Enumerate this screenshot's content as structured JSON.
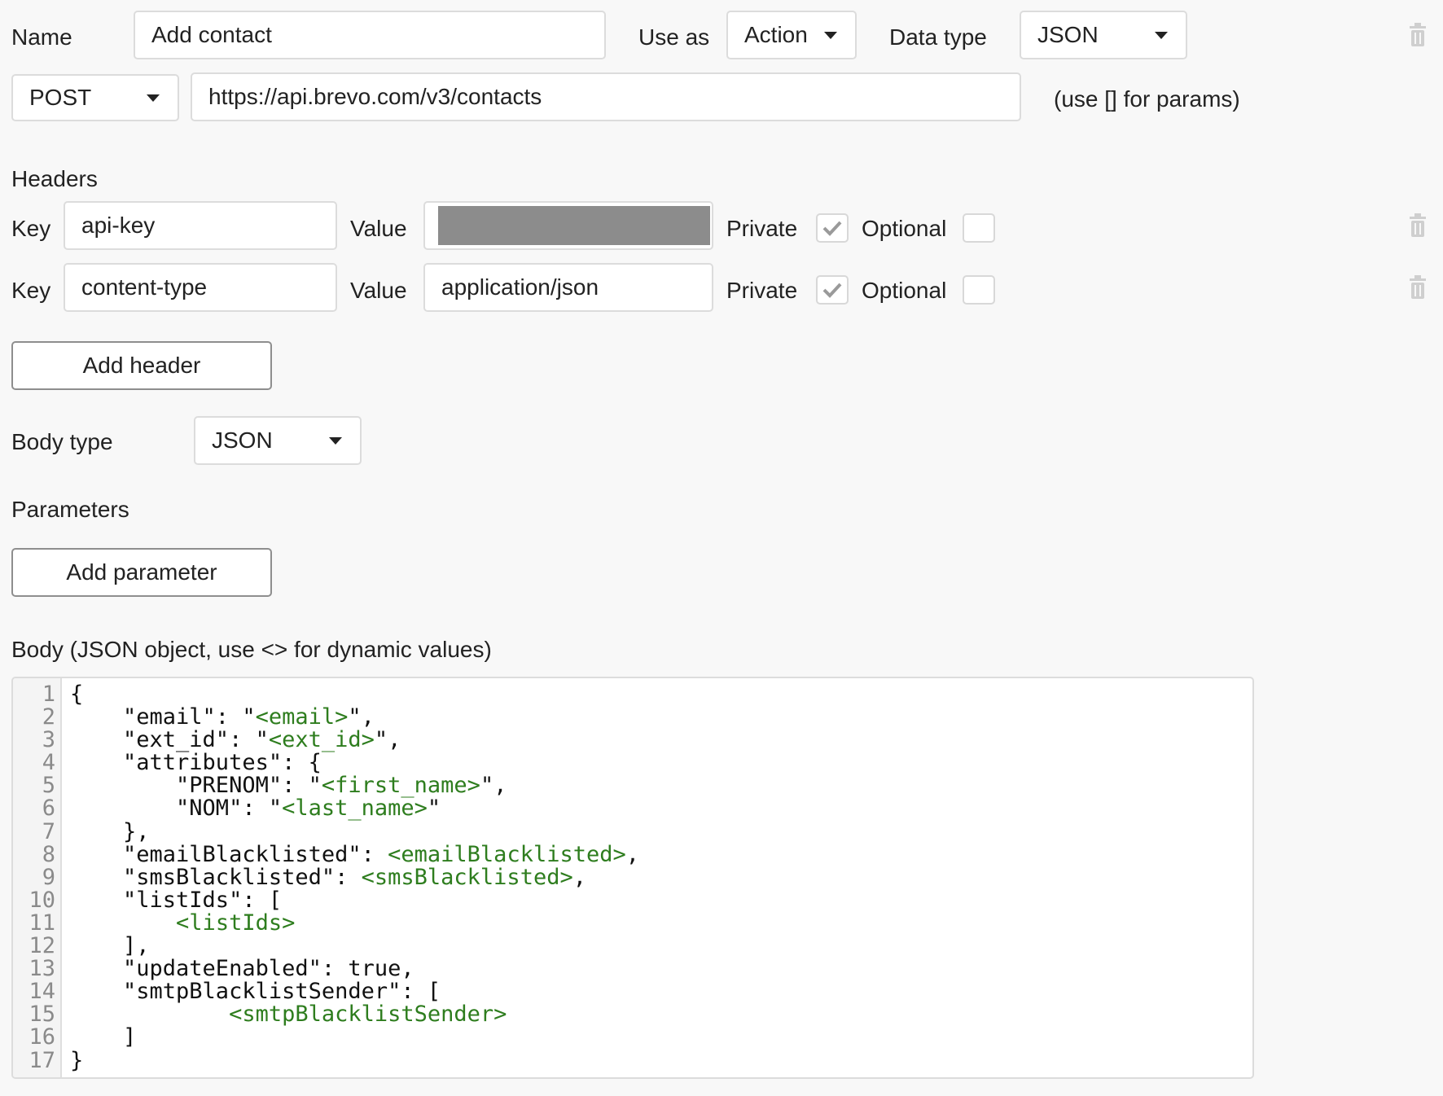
{
  "name_row": {
    "name_label": "Name",
    "name_value": "Add contact",
    "use_as_label": "Use as",
    "use_as_value": "Action",
    "data_type_label": "Data type",
    "data_type_value": "JSON"
  },
  "request_row": {
    "method": "POST",
    "url": "https://api.brevo.com/v3/contacts",
    "hint": "(use [] for params)"
  },
  "headers": {
    "title": "Headers",
    "rows": [
      {
        "key_label": "Key",
        "key": "api-key",
        "value_label": "Value",
        "value": "",
        "value_redacted": true,
        "private_label": "Private",
        "private": true,
        "optional_label": "Optional",
        "optional": false
      },
      {
        "key_label": "Key",
        "key": "content-type",
        "value_label": "Value",
        "value": "application/json",
        "value_redacted": false,
        "private_label": "Private",
        "private": true,
        "optional_label": "Optional",
        "optional": false
      }
    ],
    "add_label": "Add header"
  },
  "body_type": {
    "label": "Body type",
    "value": "JSON"
  },
  "parameters": {
    "title": "Parameters",
    "add_label": "Add parameter"
  },
  "body": {
    "title": "Body (JSON object, use <> for dynamic values)",
    "line_numbers": [
      "1",
      "2",
      "3",
      "4",
      "5",
      "6",
      "7",
      "8",
      "9",
      "10",
      "11",
      "12",
      "13",
      "14",
      "15",
      "16",
      "17"
    ],
    "lines": [
      [
        {
          "t": "{",
          "v": false
        }
      ],
      [
        {
          "t": "    \"email\": \"",
          "v": false
        },
        {
          "t": "<email>",
          "v": true
        },
        {
          "t": "\",",
          "v": false
        }
      ],
      [
        {
          "t": "    \"ext_id\": \"",
          "v": false
        },
        {
          "t": "<ext_id>",
          "v": true
        },
        {
          "t": "\",",
          "v": false
        }
      ],
      [
        {
          "t": "    \"attributes\": {",
          "v": false
        }
      ],
      [
        {
          "t": "        \"PRENOM\": \"",
          "v": false
        },
        {
          "t": "<first_name>",
          "v": true
        },
        {
          "t": "\",",
          "v": false
        }
      ],
      [
        {
          "t": "        \"NOM\": \"",
          "v": false
        },
        {
          "t": "<last_name>",
          "v": true
        },
        {
          "t": "\"",
          "v": false
        }
      ],
      [
        {
          "t": "    },",
          "v": false
        }
      ],
      [
        {
          "t": "    \"emailBlacklisted\": ",
          "v": false
        },
        {
          "t": "<emailBlacklisted>",
          "v": true
        },
        {
          "t": ",",
          "v": false
        }
      ],
      [
        {
          "t": "    \"smsBlacklisted\": ",
          "v": false
        },
        {
          "t": "<smsBlacklisted>",
          "v": true
        },
        {
          "t": ",",
          "v": false
        }
      ],
      [
        {
          "t": "    \"listIds\": [",
          "v": false
        }
      ],
      [
        {
          "t": "        ",
          "v": false
        },
        {
          "t": "<listIds>",
          "v": true
        }
      ],
      [
        {
          "t": "    ],",
          "v": false
        }
      ],
      [
        {
          "t": "    \"updateEnabled\": true,",
          "v": false
        }
      ],
      [
        {
          "t": "    \"smtpBlacklistSender\": [",
          "v": false
        }
      ],
      [
        {
          "t": "            ",
          "v": false
        },
        {
          "t": "<smtpBlacklistSender>",
          "v": true
        }
      ],
      [
        {
          "t": "    ]",
          "v": false
        }
      ],
      [
        {
          "t": "}",
          "v": false
        }
      ]
    ]
  },
  "colors": {
    "background": "#f8f8f8",
    "dynamic_value": "#2e7d1e",
    "check_mark": "#9a9a9a",
    "redacted": "#8c8c8c"
  },
  "icons": {
    "trash": "trash-icon",
    "caret": "caret-down-icon",
    "check": "check-icon"
  }
}
